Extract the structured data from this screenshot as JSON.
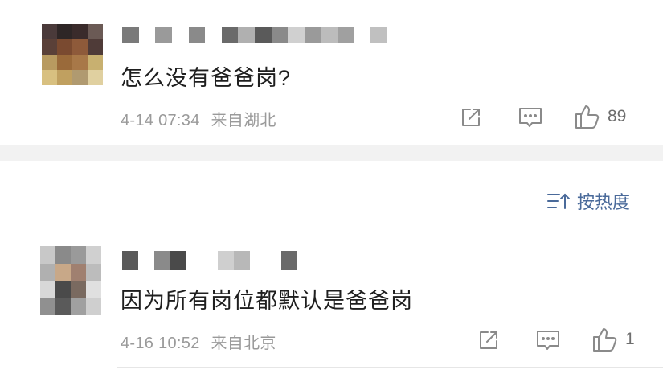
{
  "comments": [
    {
      "username": "",
      "text": "怎么没有爸爸岗?",
      "timestamp": "4-14 07:34",
      "location": "来自湖北",
      "like_count": "89",
      "actions": {
        "share_icon": "share-icon",
        "reply_icon": "reply-icon",
        "like_icon": "thumbs-up-icon"
      }
    },
    {
      "username": "",
      "text": "因为所有岗位都默认是爸爸岗",
      "timestamp": "4-16 10:52",
      "location": "来自北京",
      "like_count": "1",
      "actions": {
        "share_icon": "share-icon",
        "reply_icon": "reply-icon",
        "like_icon": "thumbs-up-icon"
      }
    }
  ],
  "sort": {
    "label": "按热度",
    "icon": "sort-icon"
  },
  "colors": {
    "divider": "#f2f2f2",
    "meta_text": "#9a9a9a",
    "sort_accent": "#4a6a9a",
    "icon_stroke": "#8a8a8a"
  }
}
